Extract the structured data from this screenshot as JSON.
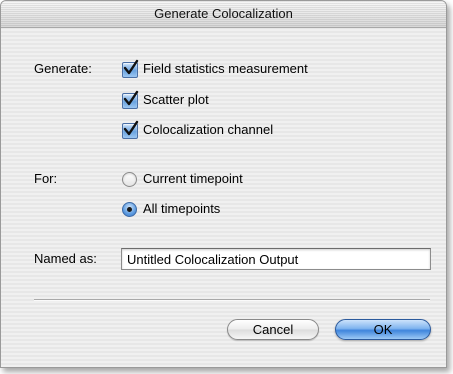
{
  "window": {
    "title": "Generate Colocalization"
  },
  "generate": {
    "label": "Generate:",
    "options": [
      {
        "label": "Field statistics measurement",
        "checked": true
      },
      {
        "label": "Scatter plot",
        "checked": true
      },
      {
        "label": "Colocalization channel",
        "checked": true
      }
    ]
  },
  "for": {
    "label": "For:",
    "options": [
      {
        "label": "Current timepoint",
        "selected": false
      },
      {
        "label": "All timepoints",
        "selected": true
      }
    ]
  },
  "named_as": {
    "label": "Named as:",
    "value": "Untitled Colocalization Output"
  },
  "buttons": {
    "cancel": "Cancel",
    "ok": "OK"
  },
  "colors": {
    "accent_blue": "#5d9be0",
    "window_bg": "#ebebeb"
  },
  "icons": {
    "checkbox": "checkmark-icon",
    "radio": "radio-dot-icon"
  }
}
